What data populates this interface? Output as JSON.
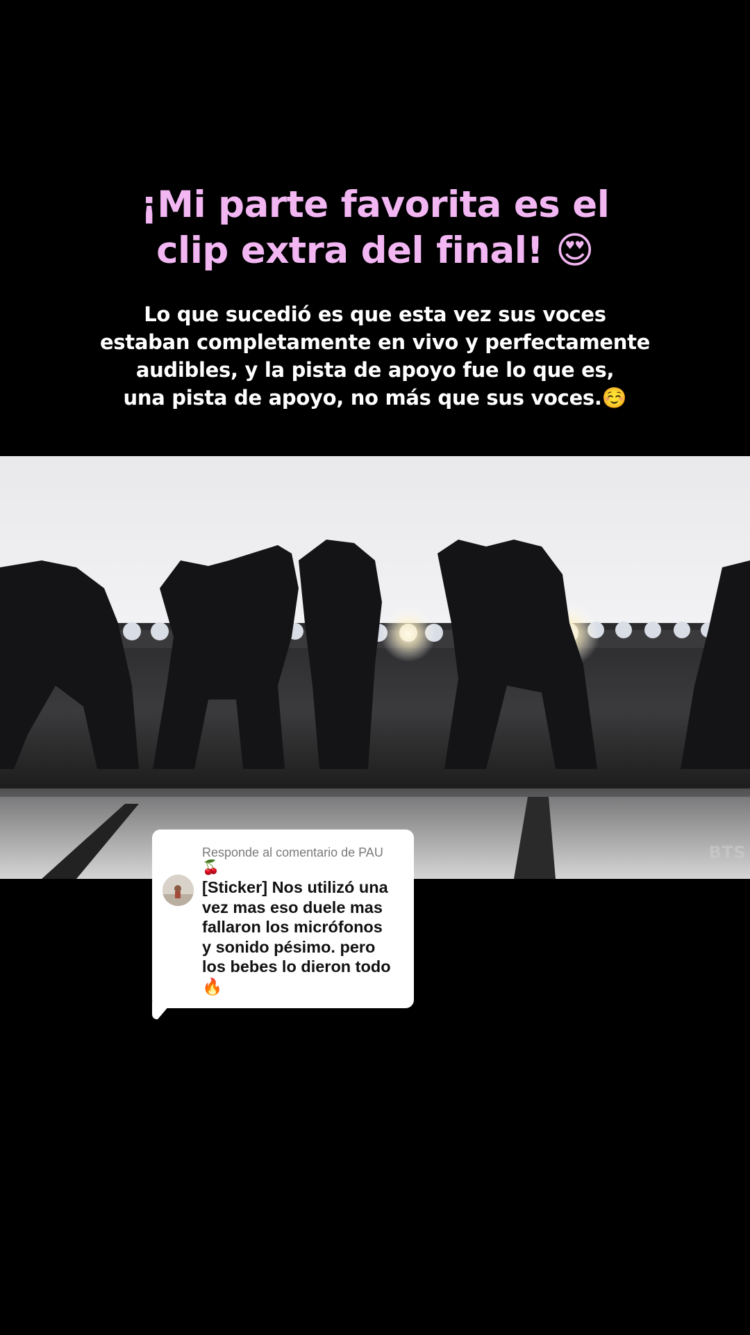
{
  "headline": {
    "line1": "¡Mi parte favorita es el",
    "line2": "clip extra del final! 😍"
  },
  "body": {
    "line1": "Lo que sucedió es que esta vez sus voces",
    "line2": "estaban completamente en vivo y perfectamente",
    "line3": "audibles, y la pista de apoyo fue lo que es,",
    "line4": "una pista de apoyo, no más que sus voces.☺️"
  },
  "video": {
    "watermark": "BTS"
  },
  "reply": {
    "header_prefix": "Responde al comentario de PAU",
    "header_emoji": "🍒",
    "lines": [
      "[Sticker] Nos utilizó una",
      "vez mas eso duele mas",
      "fallaron los micrófonos",
      "y sonido pésimo. pero",
      "los bebes lo dieron todo",
      "🔥"
    ]
  },
  "colors": {
    "background": "#000000",
    "headline": "#f2b6f2",
    "body_text": "#ffffff",
    "card": "#ffffff",
    "card_text": "#111111",
    "card_header": "#7a7a7a"
  }
}
